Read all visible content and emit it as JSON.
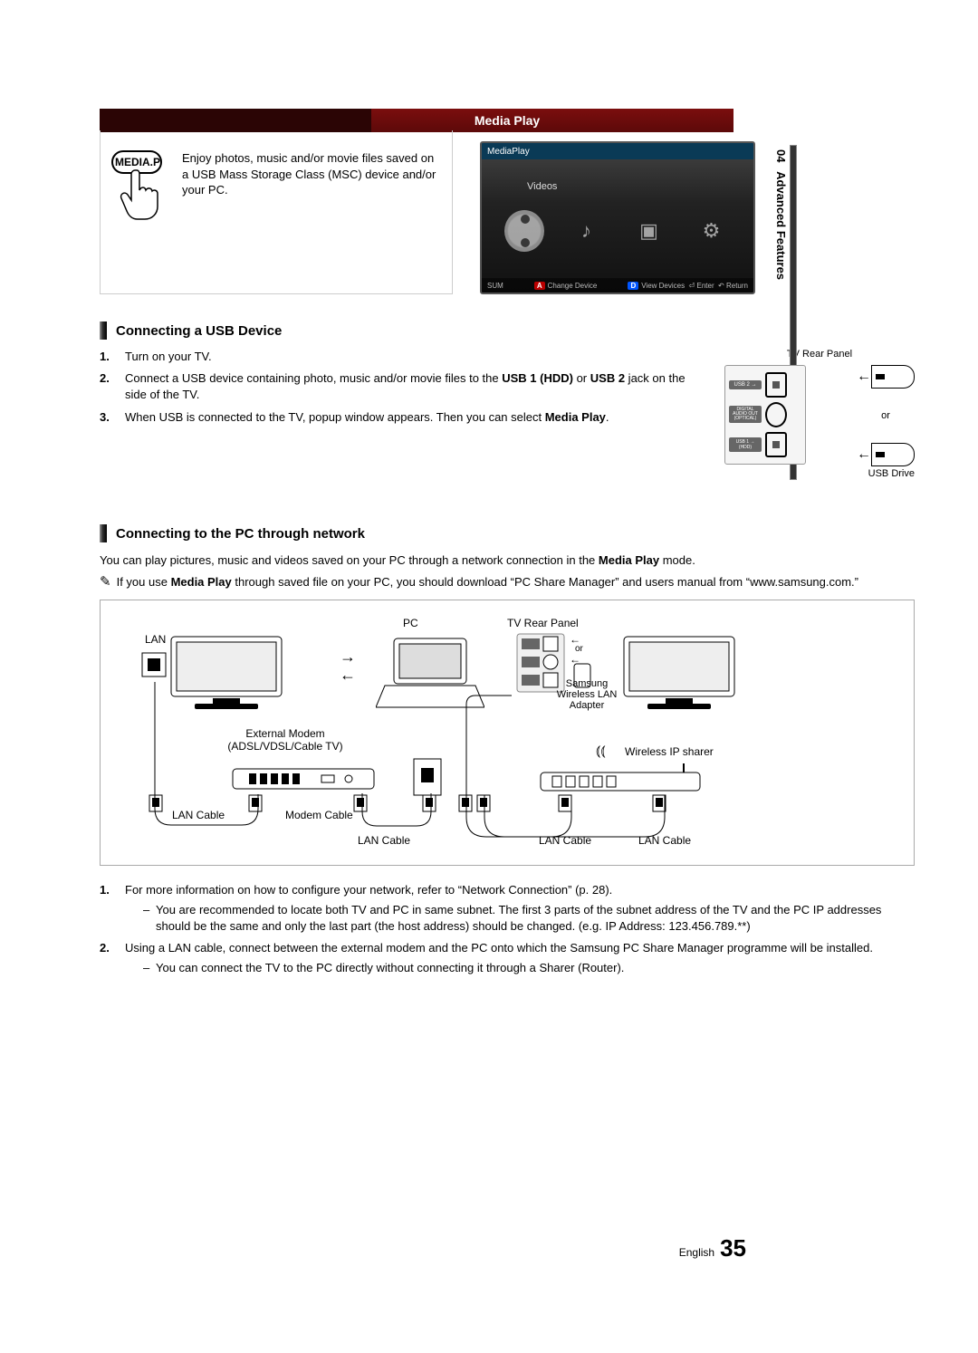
{
  "side_tab": {
    "num": "04",
    "label": "Advanced Features"
  },
  "media_bar": {
    "title": "Media Play"
  },
  "intro": {
    "button_label": "MEDIA.P",
    "text": "Enjoy photos, music and/or movie files saved on a USB Mass Storage Class (MSC) device and/or your PC."
  },
  "tv_screenshot": {
    "topbar": "MediaPlay",
    "category": "Videos",
    "bottom_left": "SUM",
    "key_a_label": "A",
    "btn_change": "Change Device",
    "key_d_label": "D",
    "btn_view": "View Devices",
    "btn_enter": "Enter",
    "btn_return": "Return"
  },
  "usb_section": {
    "heading": "Connecting a USB Device",
    "steps": [
      "Turn on your TV.",
      "Connect a USB device containing photo, music and/or movie files to the <b>USB 1 (HDD)</b> or <b>USB 2</b> jack on the side of the TV.",
      "When USB is connected to the TV, popup window appears. Then you can select <b>Media Play</b>."
    ],
    "diagram": {
      "rear_label": "TV Rear Panel",
      "usb2": "USB 2",
      "optical": "DIGITAL AUDIO OUT (OPTICAL)",
      "usb1": "USB 1 (HDD)",
      "or": "or",
      "drive_label": "USB Drive"
    }
  },
  "pc_section": {
    "heading": "Connecting to the PC through network",
    "para": "You can play pictures, music and videos saved on your PC through a network connection in the <b>Media Play</b> mode.",
    "note": "If you use <b>Media Play</b> through saved file on your PC, you should download “PC Share Manager” and users manual from “www.samsung.com.”",
    "diagram_labels": {
      "pc": "PC",
      "tv_rear": "TV Rear Panel",
      "lan": "LAN",
      "samsung_adapter": "Samsung Wireless LAN Adapter",
      "ext_modem_top": "External Modem",
      "ext_modem_sub": "(ADSL/VDSL/Cable TV)",
      "wireless_ip": "Wireless IP sharer",
      "lan_cable": "LAN Cable",
      "modem_cable": "Modem Cable",
      "or": "or"
    },
    "steps": [
      {
        "text": "For more information on how to configure your network, refer to “Network Connection” (p. 28).",
        "subs": [
          "You are recommended to locate both TV and PC in same subnet. The first 3 parts of the subnet address of the TV and the PC IP addresses should be the same and only the last part (the host address) should be changed. (e.g. IP Address: 123.456.789.**)"
        ]
      },
      {
        "text": "Using a LAN cable, connect between the external modem and the PC onto which the Samsung PC Share Manager programme will be installed.",
        "subs": [
          "You can connect the TV to the PC directly without connecting it through a Sharer (Router)."
        ]
      }
    ]
  },
  "footer": {
    "lang": "English",
    "page": "35"
  }
}
